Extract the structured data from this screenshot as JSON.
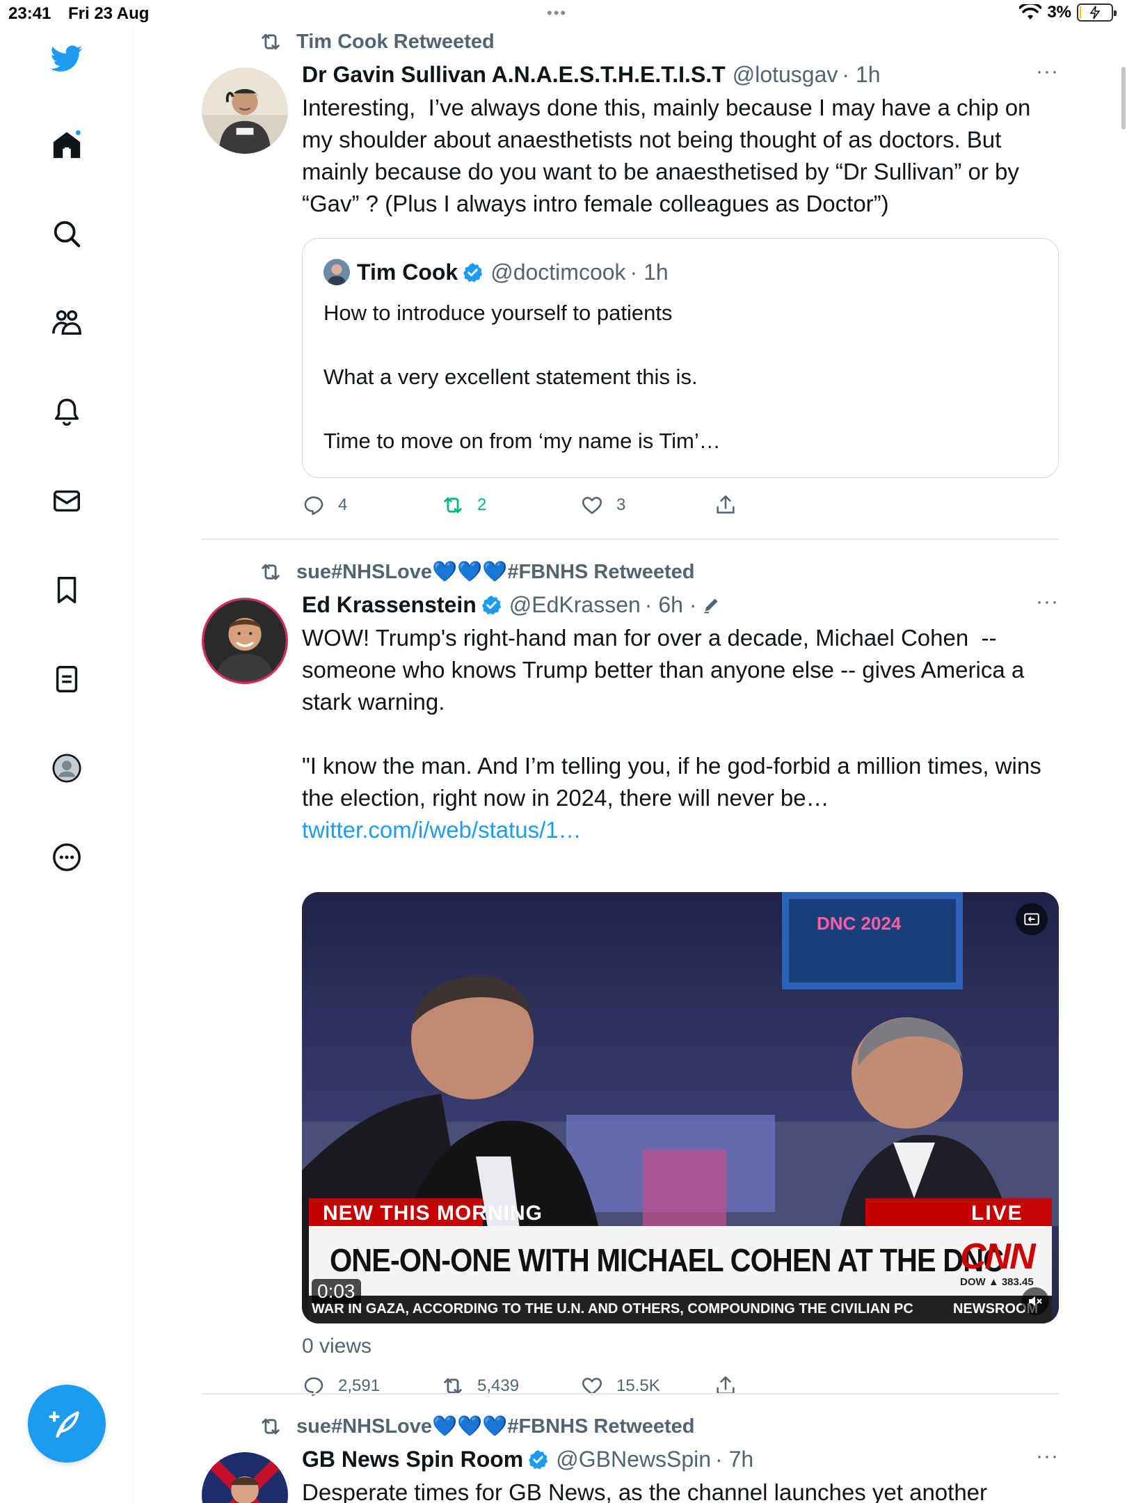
{
  "status_bar": {
    "time": "23:41",
    "date": "Fri 23 Aug",
    "battery_pct": "3%",
    "battery_level": 0.03
  },
  "sidebar": {
    "items": [
      {
        "icon": "twitter-bird-icon"
      },
      {
        "icon": "home-icon",
        "has_notification_dot": true
      },
      {
        "icon": "search-icon"
      },
      {
        "icon": "communities-icon"
      },
      {
        "icon": "notifications-icon"
      },
      {
        "icon": "messages-icon"
      },
      {
        "icon": "bookmarks-icon"
      },
      {
        "icon": "lists-icon"
      },
      {
        "icon": "profile-icon"
      },
      {
        "icon": "more-icon"
      }
    ],
    "compose_icon": "compose-feather-icon"
  },
  "colors": {
    "accent": "#1d9bf0",
    "retweet_green": "#00ba7c",
    "secondary_text": "#536471",
    "cnn_red": "#cc0000"
  },
  "tweets": [
    {
      "retweeted_by": "Tim Cook Retweeted",
      "name": "Dr Gavin Sullivan A.N.A.E.S.T.H.E.T.I.S.T",
      "handle": "@lotusgav",
      "time": "· 1h",
      "more": "···",
      "text": "Interesting,  I’ve always done this, mainly because I may have a chip on my shoulder about anaesthetists not being thought of as doctors. But mainly because do you want to be anaesthetised by “Dr Sullivan” or by “Gav” ? (Plus I always intro female colleagues as Doctor”)",
      "quote": {
        "name": "Tim Cook",
        "handle": "@doctimcook",
        "time": "· 1h",
        "text": "How to introduce yourself to patients\n\nWhat a very excellent statement this is.\n\nTime to move on from ‘my name is Tim’…"
      },
      "stats": {
        "replies": "4",
        "retweets": "2",
        "likes": "3"
      }
    },
    {
      "retweeted_by": "sue#NHSLove💙💙💙#FBNHS Retweeted",
      "name": "Ed Krassenstein",
      "handle": "@EdKrassen",
      "time": "· 6h ·",
      "more": "···",
      "text": "WOW! Trump's right-hand man for over a decade, Michael Cohen  -- someone who knows Trump better than anyone else -- gives America a stark warning.\n\n\"I know the man. And I’m telling you, if he god-forbid a million times, wins the election, right now in 2024, there will never be… ",
      "link": "twitter.com/i/web/status/1…",
      "video": {
        "banner_top": "NEW THIS MORNING",
        "live": "LIVE",
        "headline": "ONE-ON-ONE WITH MICHAEL COHEN AT THE DNC",
        "logo": "CNN",
        "ticker": "WAR IN GAZA, ACCORDING TO THE U.N. AND OTHERS, COMPOUNDING THE CIVILIAN PC",
        "ticker_brand": "NEWSROOM",
        "dow": "DOW ▲ 383.45",
        "duration": "0:03",
        "stage_sign": "DNC 2024"
      },
      "views": "0 views",
      "stats": {
        "replies": "2,591",
        "retweets": "5,439",
        "likes": "15.5K"
      }
    },
    {
      "retweeted_by": "sue#NHSLove💙💙💙#FBNHS Retweeted",
      "name": "GB News Spin Room",
      "handle": "@GBNewsSpin",
      "time": "· 7h",
      "more": "···",
      "text": "Desperate times for GB News, as the channel launches yet another"
    }
  ]
}
